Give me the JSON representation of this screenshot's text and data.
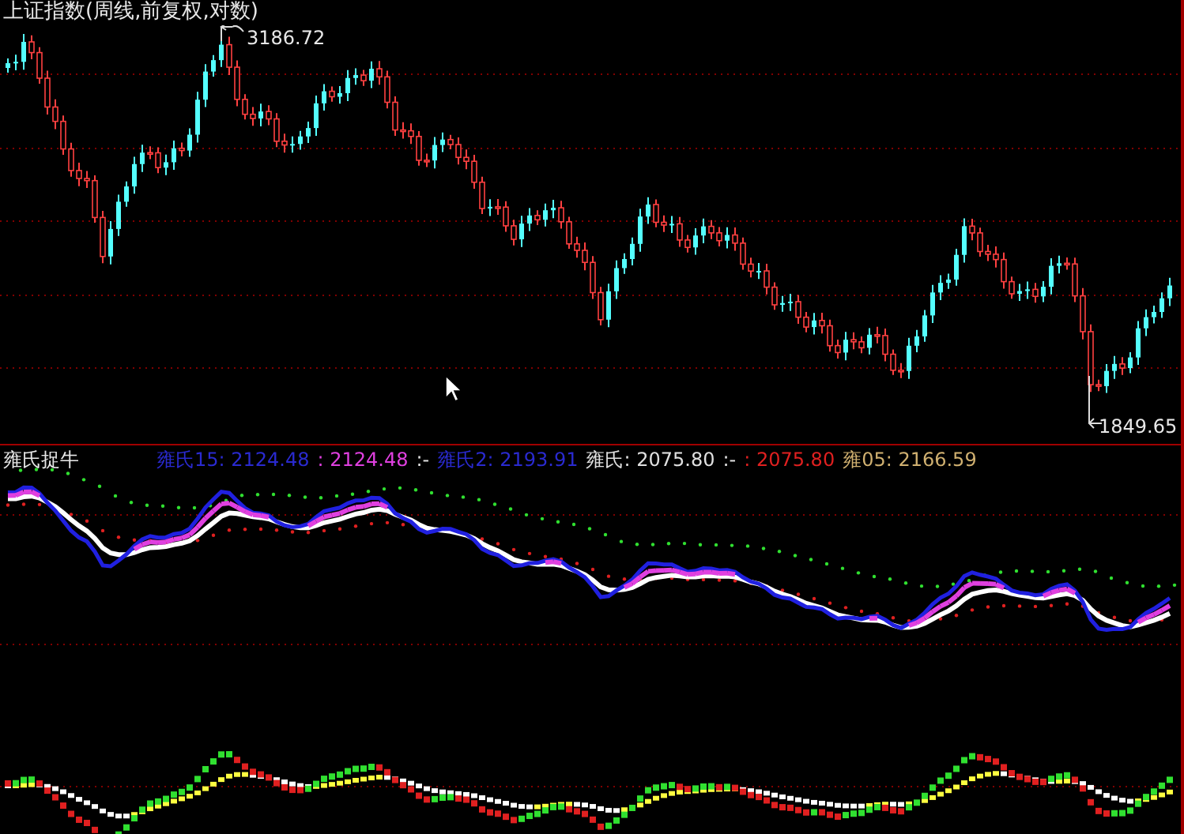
{
  "price_panel": {
    "title": "上证指数(周线,前复权,对数)",
    "high_label": "3186.72",
    "low_label": "1849.65"
  },
  "indicator_panel": {
    "name": "雍氏捉牛",
    "legend": [
      {
        "text": "雍氏15: 2124.48",
        "color": "#2a2ad0"
      },
      {
        "text": ": 2124.48",
        "color": "#e040e0"
      },
      {
        "text": ":-",
        "color": "#e0e0e0"
      },
      {
        "text": "雍氏2: 2193.91",
        "color": "#2a2ad0"
      },
      {
        "text": "雍氏: 2075.80",
        "color": "#e0e0e0"
      },
      {
        "text": ":-",
        "color": "#e0e0e0"
      },
      {
        "text": ": 2075.80",
        "color": "#e02020"
      },
      {
        "text": "雍05: 2166.59",
        "color": "#d0b070"
      }
    ]
  }
}
